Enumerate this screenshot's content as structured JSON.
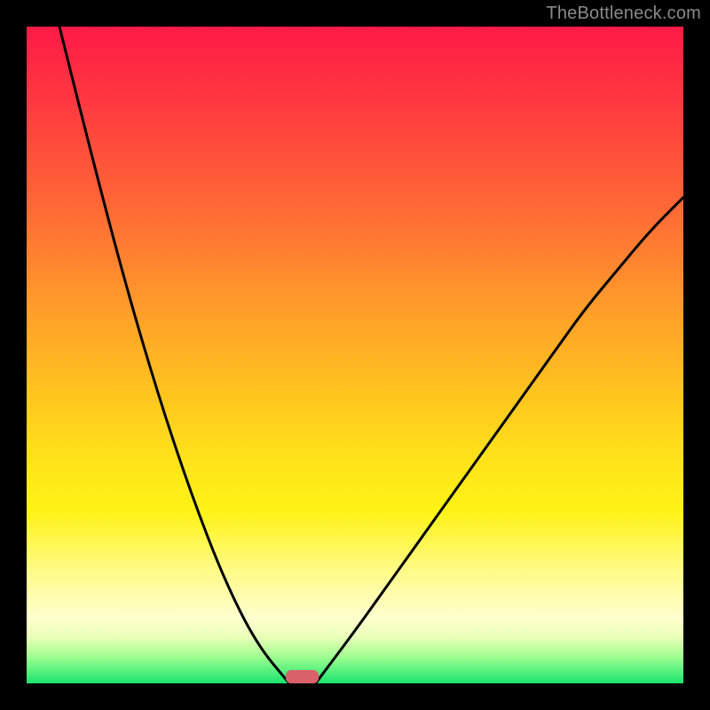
{
  "watermark": "TheBottleneck.com",
  "chart_data": {
    "type": "line",
    "title": "",
    "xlabel": "",
    "ylabel": "",
    "xlim": [
      0,
      100
    ],
    "ylim": [
      0,
      100
    ],
    "grid": false,
    "legend": false,
    "gradient_stops": [
      {
        "pos": 0.0,
        "color": "#ff1a47"
      },
      {
        "pos": 0.28,
        "color": "#ff6a35"
      },
      {
        "pos": 0.55,
        "color": "#ffc21f"
      },
      {
        "pos": 0.74,
        "color": "#fff317"
      },
      {
        "pos": 0.9,
        "color": "#ffffcf"
      },
      {
        "pos": 1.0,
        "color": "#19e36e"
      }
    ],
    "series": [
      {
        "name": "left-branch",
        "x": [
          5,
          10,
          15,
          20,
          25,
          30,
          35,
          40
        ],
        "y": [
          100,
          80,
          61,
          44,
          29,
          16,
          6,
          0
        ]
      },
      {
        "name": "right-branch",
        "x": [
          44,
          50,
          55,
          60,
          65,
          70,
          75,
          80,
          85,
          90,
          95,
          100
        ],
        "y": [
          0,
          8,
          15,
          22,
          29,
          36,
          43,
          50,
          57,
          63,
          69,
          74
        ]
      }
    ],
    "marker": {
      "x": 42,
      "y": 0,
      "width": 5,
      "height": 2,
      "color": "#d9616a"
    }
  }
}
